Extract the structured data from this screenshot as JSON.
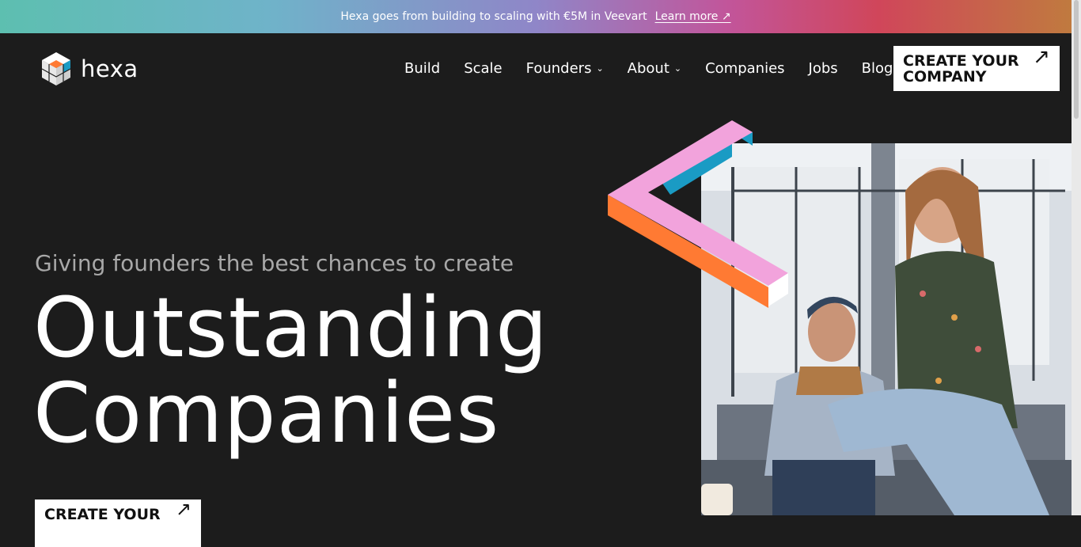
{
  "banner": {
    "text": "Hexa goes from building to scaling with €5M in Veevart",
    "link": "Learn more ↗"
  },
  "logo": {
    "text": "hexa",
    "icon": "cube-logo-icon"
  },
  "nav": {
    "items": [
      {
        "label": "Build"
      },
      {
        "label": "Scale"
      },
      {
        "label": "Founders",
        "has_dropdown": true
      },
      {
        "label": "About",
        "has_dropdown": true
      },
      {
        "label": "Companies"
      },
      {
        "label": "Jobs"
      },
      {
        "label": "Blog"
      }
    ],
    "cta_line1": "CREATE YOUR",
    "cta_line2": "COMPANY",
    "cta_icon": "arrow-up-right-icon"
  },
  "hero": {
    "subtitle": "Giving founders the best chances to create",
    "headline_line1": "Outstanding",
    "headline_line2": "Companies",
    "cta_line1": "CREATE YOUR",
    "image_alt": "Two founders sitting on a couch smiling"
  },
  "colors": {
    "background": "#1c1c1c",
    "shape_pink": "#f2a3dc",
    "shape_orange": "#ff7a33",
    "shape_teal": "#1a9bc4"
  }
}
